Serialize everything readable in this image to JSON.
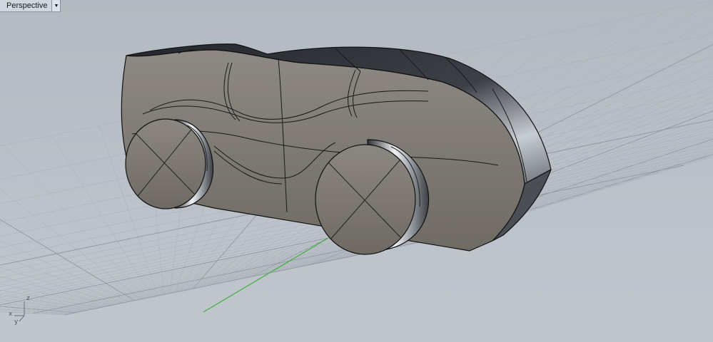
{
  "viewport": {
    "title": "Perspective",
    "dropdown_icon": "triangle-down-icon"
  },
  "axis_widget": {
    "x_label": "x",
    "y_label": "y",
    "z_label": "z"
  },
  "colors": {
    "background": "#b8bec5",
    "grid_minor": "#aab0b7",
    "grid_major": "#8f969e",
    "y_axis_line": "#3fae3f",
    "car_body": "#7d7770",
    "edge": "#111111"
  }
}
